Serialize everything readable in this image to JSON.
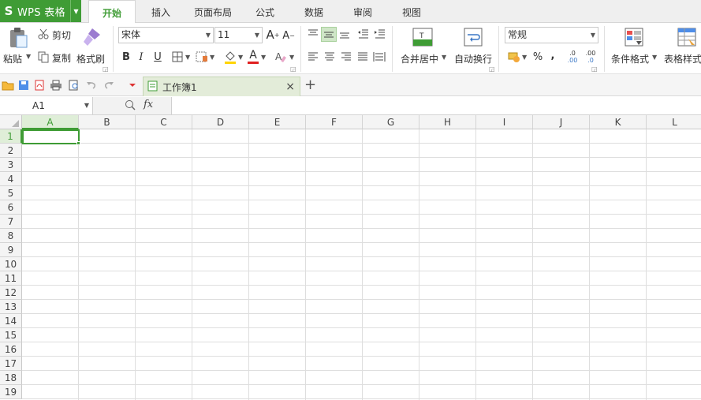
{
  "app": {
    "logo": "S",
    "title": "WPS 表格"
  },
  "ribbon_tabs": [
    "开始",
    "插入",
    "页面布局",
    "公式",
    "数据",
    "审阅",
    "视图"
  ],
  "active_tab": "开始",
  "clipboard": {
    "paste": "粘贴",
    "cut": "剪切",
    "copy": "复制",
    "format_painter": "格式刷"
  },
  "font": {
    "name": "宋体",
    "size": "11",
    "bold": "B",
    "italic": "I",
    "underline": "U",
    "grow": "A",
    "shrink": "A",
    "font_color_glyph": "A"
  },
  "alignment": {
    "merge_center": "合并居中",
    "wrap_text": "自动换行"
  },
  "number": {
    "format": "常规",
    "percent": "%",
    "comma": ",",
    "inc_decimal": ".00",
    "dec_decimal": ".0"
  },
  "styles": {
    "conditional_format": "条件格式",
    "table_style": "表格样式"
  },
  "document": {
    "tab_name": "工作簿1"
  },
  "formula_bar": {
    "name_box": "A1",
    "fx": "fx",
    "value": ""
  },
  "sheet": {
    "columns": [
      "A",
      "B",
      "C",
      "D",
      "E",
      "F",
      "G",
      "H",
      "I",
      "J",
      "K",
      "L"
    ],
    "rows": [
      "1",
      "2",
      "3",
      "4",
      "5",
      "6",
      "7",
      "8",
      "9",
      "10",
      "11",
      "12",
      "13",
      "14",
      "15",
      "16",
      "17",
      "18",
      "19"
    ],
    "active_cell": "A1"
  },
  "colors": {
    "accent": "#3f9c35",
    "grid": "#dedede",
    "header_bg": "#f4f4f4"
  }
}
